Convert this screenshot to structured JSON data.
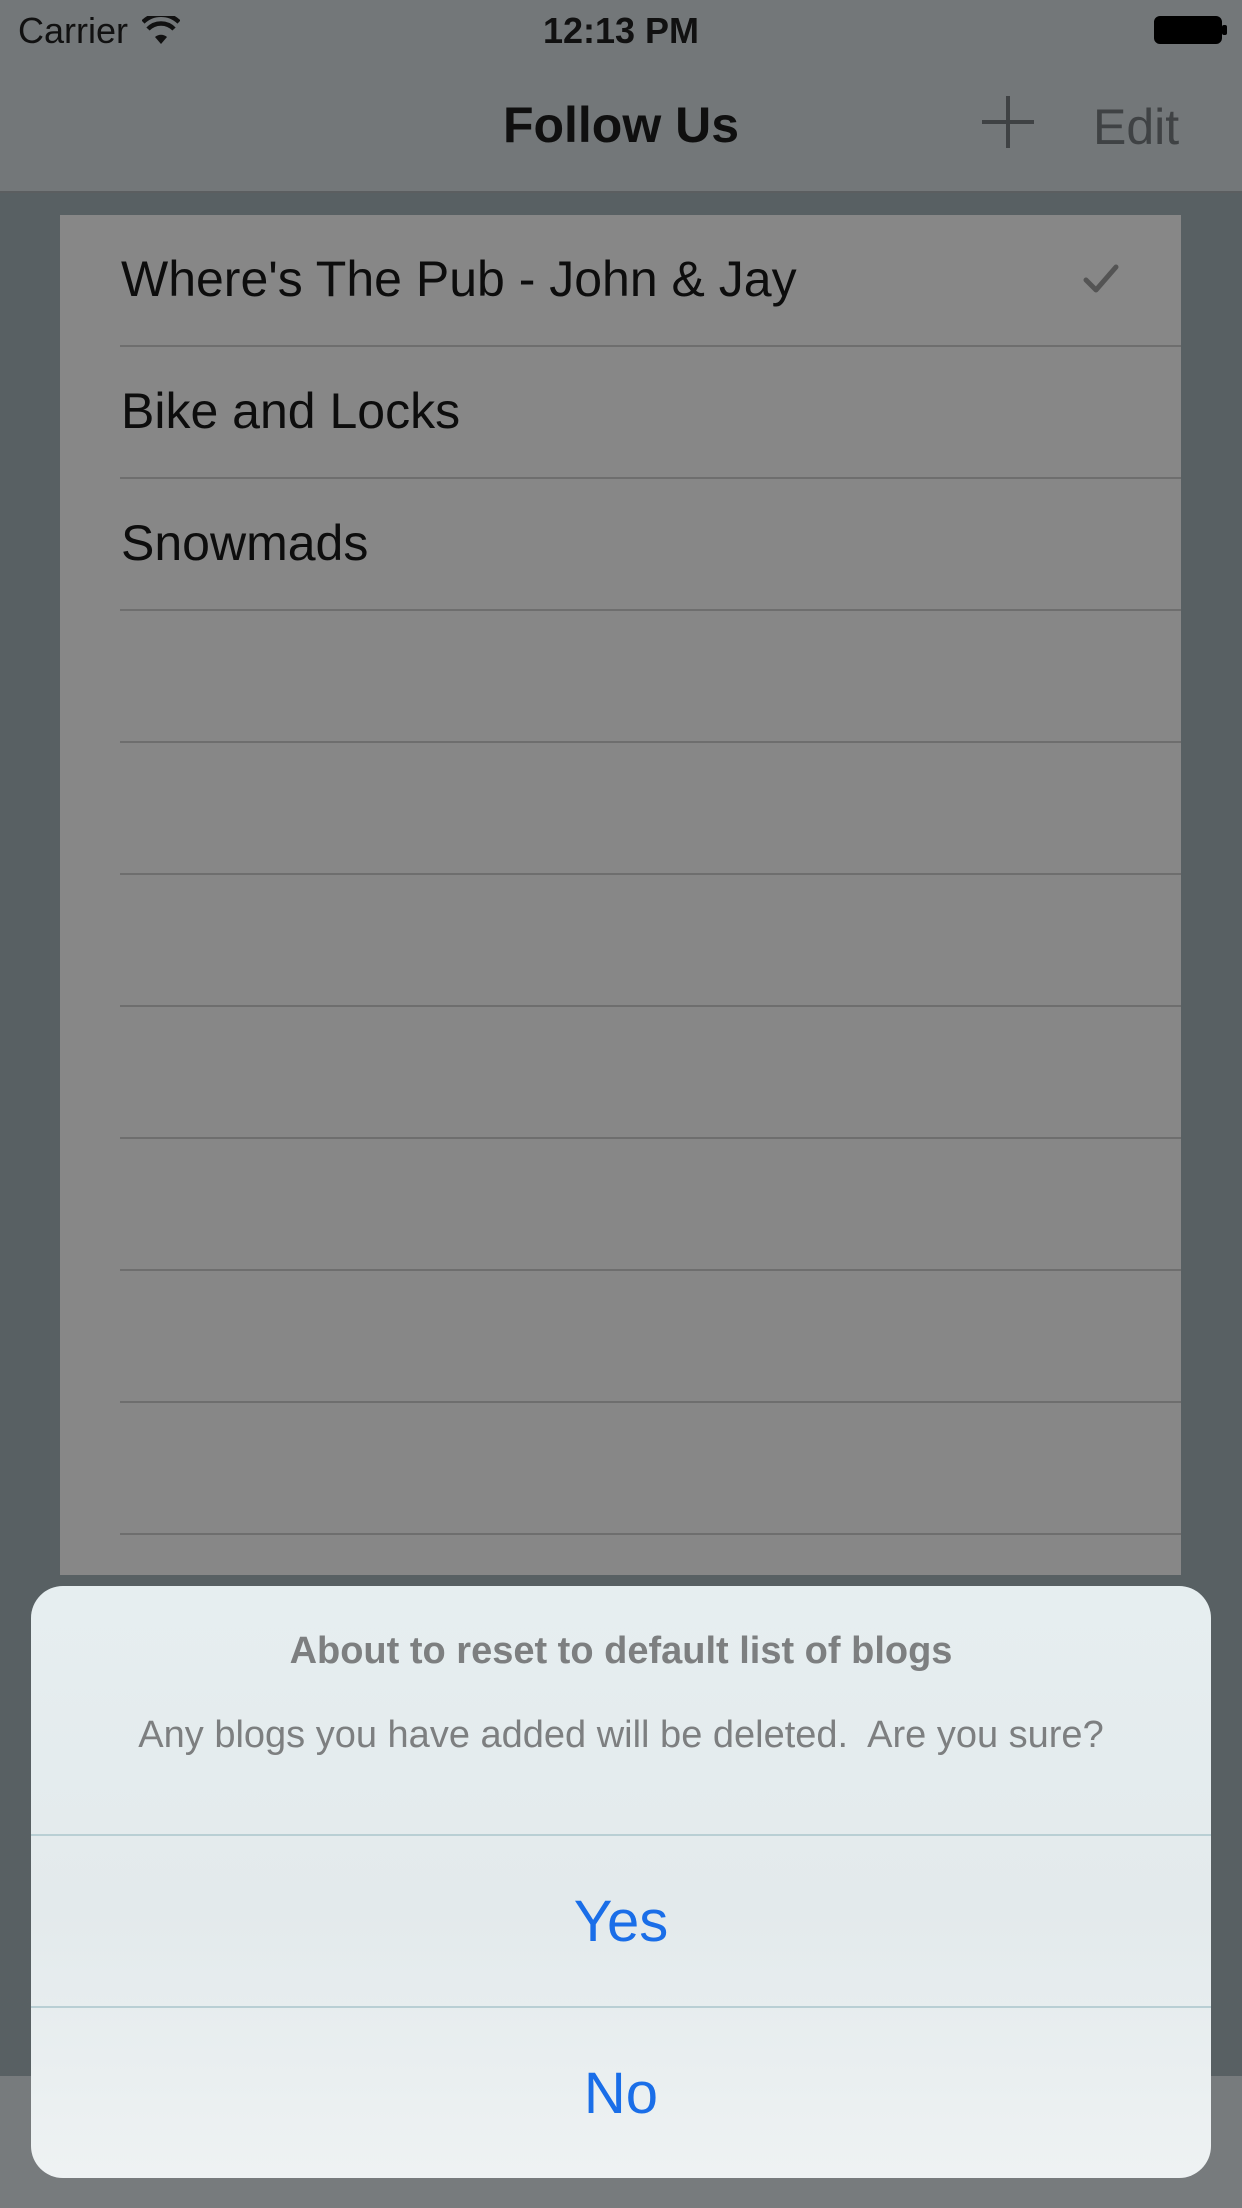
{
  "status_bar": {
    "carrier": "Carrier",
    "time": "12:13 PM",
    "wifi_icon": "wifi-icon",
    "battery_icon": "battery-full-icon"
  },
  "nav": {
    "title": "Follow Us",
    "add_icon": "plus-icon",
    "edit_label": "Edit"
  },
  "list": {
    "rows": [
      {
        "label": "Where's The Pub - John & Jay",
        "checked": true
      },
      {
        "label": "Bike and Locks",
        "checked": false
      },
      {
        "label": "Snowmads",
        "checked": false
      },
      {
        "label": "",
        "checked": false
      },
      {
        "label": "",
        "checked": false
      },
      {
        "label": "",
        "checked": false
      },
      {
        "label": "",
        "checked": false
      },
      {
        "label": "",
        "checked": false
      },
      {
        "label": "",
        "checked": false
      },
      {
        "label": "",
        "checked": false
      }
    ]
  },
  "action_sheet": {
    "title": "About to reset to default list of blogs",
    "message": "Any blogs you have added will be deleted.  Are you sure?",
    "yes_label": "Yes",
    "no_label": "No"
  },
  "colors": {
    "accent": "#1a6ee8",
    "overlay": "#5a6264"
  }
}
